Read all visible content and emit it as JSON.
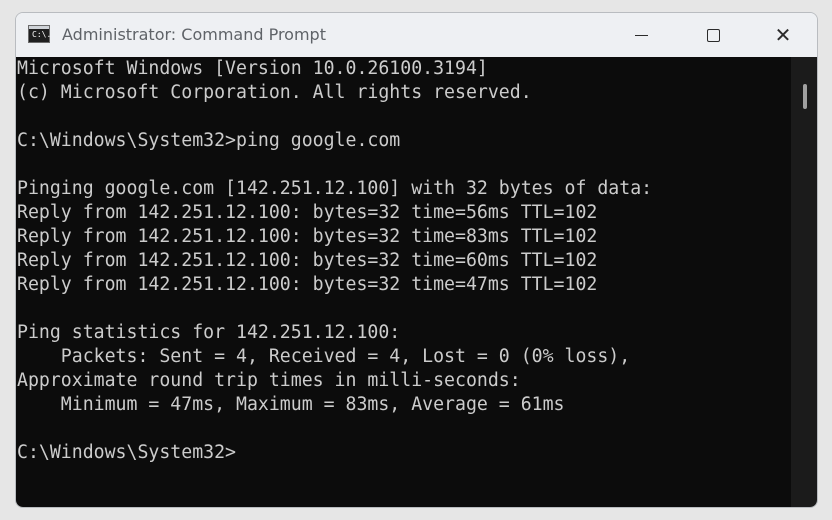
{
  "window": {
    "title": "Administrator: Command Prompt",
    "icon_label": "C:\\."
  },
  "controls": {
    "minimize_icon": "minimize-icon",
    "maximize_icon": "maximize-icon",
    "close_icon": "close-icon",
    "close_glyph": "✕"
  },
  "console": {
    "background": "#0c0c0c",
    "foreground": "#cccccc",
    "lines": [
      "Microsoft Windows [Version 10.0.26100.3194]",
      "(c) Microsoft Corporation. All rights reserved.",
      "",
      "C:\\Windows\\System32>ping google.com",
      "",
      "Pinging google.com [142.251.12.100] with 32 bytes of data:",
      "Reply from 142.251.12.100: bytes=32 time=56ms TTL=102",
      "Reply from 142.251.12.100: bytes=32 time=83ms TTL=102",
      "Reply from 142.251.12.100: bytes=32 time=60ms TTL=102",
      "Reply from 142.251.12.100: bytes=32 time=47ms TTL=102",
      "",
      "Ping statistics for 142.251.12.100:",
      "    Packets: Sent = 4, Received = 4, Lost = 0 (0% loss),",
      "Approximate round trip times in milli-seconds:",
      "    Minimum = 47ms, Maximum = 83ms, Average = 61ms",
      "",
      "C:\\Windows\\System32>"
    ]
  }
}
